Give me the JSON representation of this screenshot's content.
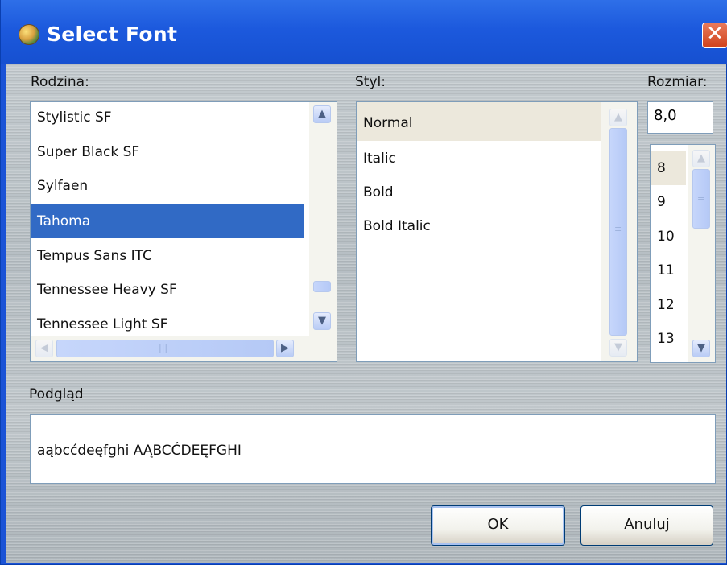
{
  "window": {
    "title": "Select Font",
    "close_label": "✕"
  },
  "family": {
    "label": "Rodzina:",
    "items": [
      "Stylistic SF",
      "Super Black SF",
      "Sylfaen",
      "Tahoma",
      "Tempus Sans ITC",
      "Tennessee Heavy SF",
      "Tennessee Light SF"
    ],
    "selected": "Tahoma"
  },
  "style": {
    "label": "Styl:",
    "items": [
      "Normal",
      "Italic",
      "Bold",
      "Bold Italic"
    ],
    "selected": "Normal"
  },
  "size": {
    "label": "Rozmiar:",
    "value": "8,0",
    "items": [
      "8",
      "9",
      "10",
      "11",
      "12",
      "13"
    ],
    "selected": "8"
  },
  "preview": {
    "label": "Podgląd",
    "sample": "aąbcćdeęfghi AĄBCĆDEĘFGHI"
  },
  "buttons": {
    "ok": "OK",
    "cancel": "Anuluj"
  },
  "icons": {
    "scroll_up": "▲",
    "scroll_down": "▼",
    "scroll_left": "◀",
    "scroll_right": "▶",
    "grip": "≡",
    "grip_h": "|||"
  },
  "colors": {
    "titlebar": "#1c59dd",
    "selection": "#316ac5",
    "hover": "#ece8dc"
  }
}
